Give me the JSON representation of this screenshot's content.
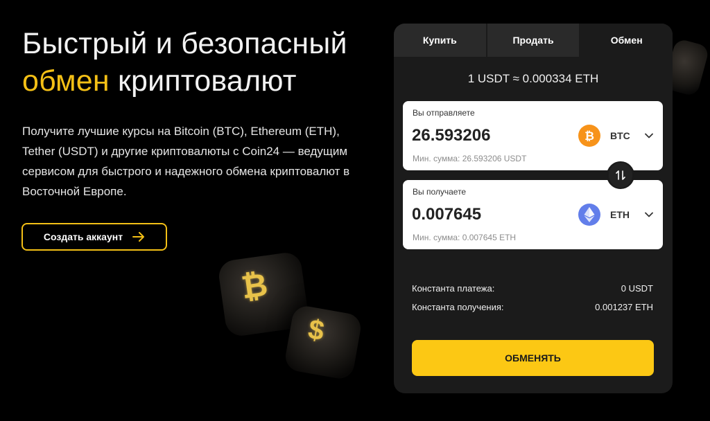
{
  "hero": {
    "title_line1": "Быстрый и безопасный",
    "title_accent": "обмен",
    "title_rest": " криптовалют",
    "description": "Получите лучшие курсы на Bitcoin (BTC), Ethereum (ETH), Tether (USDT) и другие криптовалюты с Coin24 — ведущим сервисом для быстрого и надежного обмена криптовалют в Восточной Европе.",
    "cta_label": "Создать аккаунт",
    "cta_icon": "arrow-right-icon"
  },
  "exchange": {
    "tabs": [
      {
        "label": "Купить",
        "active": false
      },
      {
        "label": "Продать",
        "active": false
      },
      {
        "label": "Обмен",
        "active": true
      }
    ],
    "rate": "1 USDT ≈ 0.000334 ETH",
    "send": {
      "label": "Вы отправляете",
      "value": "26.593206",
      "min": "Мин. сумма: 26.593206 USDT",
      "currency": "BTC",
      "icon": "bitcoin-icon"
    },
    "receive": {
      "label": "Вы получаете",
      "value": "0.007645",
      "min": "Мин. сумма: 0.007645 ETH",
      "currency": "ETH",
      "icon": "ethereum-icon"
    },
    "info": [
      {
        "label": "Константа платежа:",
        "value": "0 USDT"
      },
      {
        "label": "Константа получения:",
        "value": "0.001237 ETH"
      }
    ],
    "submit_label": "ОБМЕНЯТЬ"
  },
  "colors": {
    "accent": "#f4c016",
    "button": "#fcc814",
    "card": "#1b1b1b",
    "btc": "#f7931a",
    "eth": "#627eea"
  }
}
